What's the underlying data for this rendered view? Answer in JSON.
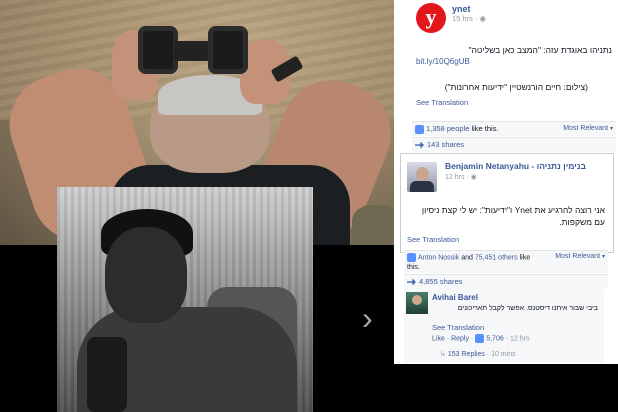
{
  "post": {
    "page_name": "ynet",
    "logo_letter": "y",
    "time": "15 hrs · ◉",
    "text": "נתניהו באוגדת עזה: \"המצב כאן בשליטה\"",
    "link": "bit.ly/10Q6gUB",
    "credit": "(צילום: חיים הורנשטיין \"ידיעות אחרונות\")",
    "see_translation": "See Translation",
    "likes_count": "1,358 people",
    "likes_suffix": " like this.",
    "most_relevant": "Most Relevant",
    "shares": "143 shares"
  },
  "comment": {
    "name": "Benjamin Netanyahu - בנימין נתניהו",
    "time": "12 hrs · ◉",
    "text": "אני רוצה להרגיע את Ynet ו\"ידיעות\": יש לי קצת ניסיון עם משקפות.",
    "see_translation": "See Translation",
    "likes_names": "Anton Nossik",
    "likes_and": " and ",
    "likes_others": "75,451 others",
    "likes_suffix": " like this.",
    "most_relevant": "Most Relevant",
    "shares": "4,855 shares"
  },
  "reply": {
    "name": "Avihai Barel",
    "text": "ביבי שבור איתנו דיסטנס. אפשר לקבל תאריכונים",
    "see_translation": "See Translation",
    "like": "Like",
    "reply": "Reply",
    "likes": "5,706",
    "time": "12 hrs",
    "replies": "153 Replies",
    "replies_time": "10 mins"
  },
  "icons": {
    "next": "chevron-right-icon",
    "thumb": "thumbs-up-icon",
    "share": "share-icon"
  },
  "colors": {
    "link": "#3b5998",
    "brand_ynet": "#e2161b"
  }
}
